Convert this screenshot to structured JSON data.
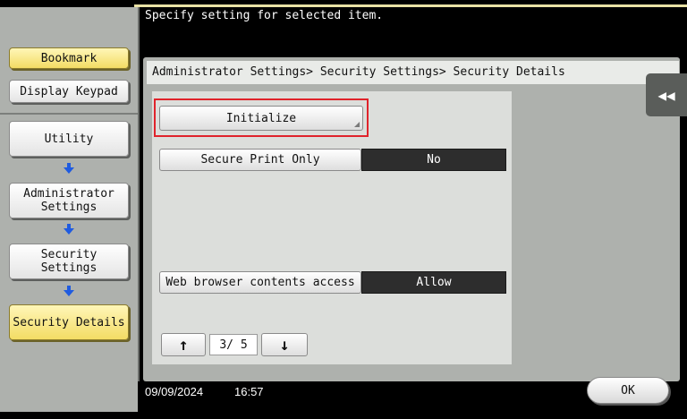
{
  "message": "Specify setting for selected item.",
  "breadcrumb": "Administrator Settings> Security Settings> Security Details",
  "sidebar": {
    "bookmark": "Bookmark",
    "display_keypad": "Display Keypad",
    "nav": [
      {
        "label_line1": "Utility",
        "label_line2": ""
      },
      {
        "label_line1": "Administrator",
        "label_line2": "Settings"
      },
      {
        "label_line1": "Security",
        "label_line2": "Settings"
      },
      {
        "label_line1": "Security Details",
        "label_line2": ""
      }
    ]
  },
  "main": {
    "initialize": "Initialize",
    "secure_print_label": "Secure Print Only",
    "secure_print_value": "No",
    "web_access_label": "Web browser contents access",
    "web_access_value": "Allow",
    "page_indicator": "3/ 5"
  },
  "footer": {
    "date": "09/09/2024",
    "time": "16:57",
    "ok": "OK"
  },
  "colors": {
    "accent_yellow": "#f3dc64",
    "highlight_red": "#e0232b",
    "arrow_blue": "#1f5be0"
  }
}
